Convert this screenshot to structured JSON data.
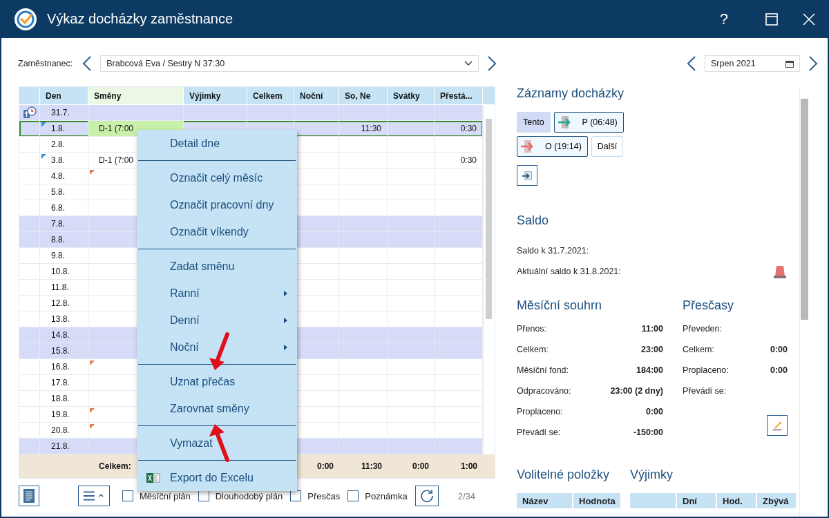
{
  "window": {
    "title": "Výkaz docházky zaměstnance",
    "help": "?"
  },
  "employee": {
    "label": "Zaměstnanec:",
    "value": "Brabcová Eva / Sestry N 37:30"
  },
  "month": {
    "value": "Srpen 2021"
  },
  "table": {
    "columns": [
      "Den",
      "Směny",
      "Výjimky",
      "Celkem",
      "Noční",
      "So, Ne",
      "Svátky",
      "Přestá..."
    ],
    "rows": [
      {
        "den": "31.7.",
        "weekend": true,
        "selected": false,
        "icon": true
      },
      {
        "den": "1.8.",
        "smeny": "D-1 (7:00",
        "so_ne": "11:30",
        "prescas": "0:30",
        "weekend": true,
        "selected": true,
        "note": true,
        "flag": false
      },
      {
        "den": "2.8.",
        "weekend": false,
        "selected": false
      },
      {
        "den": "3.8.",
        "smeny": "D-1 (7:00",
        "prescas": "0:30",
        "weekend": false,
        "selected": false,
        "note": true,
        "flag": false
      },
      {
        "den": "4.8.",
        "weekend": false,
        "selected": false,
        "note": false,
        "flag": true
      },
      {
        "den": "5.8.",
        "weekend": false,
        "selected": false
      },
      {
        "den": "6.8.",
        "weekend": false,
        "selected": false
      },
      {
        "den": "7.8.",
        "weekend": true,
        "selected": false
      },
      {
        "den": "8.8.",
        "weekend": true,
        "selected": false
      },
      {
        "den": "9.8.",
        "weekend": false,
        "selected": false
      },
      {
        "den": "10.8.",
        "weekend": false,
        "selected": false
      },
      {
        "den": "11.8.",
        "weekend": false,
        "selected": false
      },
      {
        "den": "12.8.",
        "weekend": false,
        "selected": false
      },
      {
        "den": "13.8.",
        "weekend": false,
        "selected": false
      },
      {
        "den": "14.8.",
        "weekend": true,
        "selected": false
      },
      {
        "den": "15.8.",
        "weekend": true,
        "selected": false
      },
      {
        "den": "16.8.",
        "weekend": false,
        "selected": false,
        "note": false,
        "flag": true
      },
      {
        "den": "17.8.",
        "weekend": false,
        "selected": false
      },
      {
        "den": "18.8.",
        "weekend": false,
        "selected": false
      },
      {
        "den": "19.8.",
        "weekend": false,
        "selected": false,
        "note": false,
        "flag": true
      },
      {
        "den": "20.8.",
        "weekend": false,
        "selected": false,
        "note": false,
        "flag": true
      },
      {
        "den": "21.8.",
        "weekend": true,
        "selected": false
      }
    ],
    "footer": {
      "label": "Celkem:",
      "nocni": "0:00",
      "so_ne": "11:30",
      "svatky": "0:00",
      "prescas": "1:00"
    }
  },
  "context_menu": [
    [
      {
        "label": "Detail dne",
        "submenu": false
      }
    ],
    [
      {
        "label": "Označit celý měsíc",
        "submenu": false
      },
      {
        "label": "Označit pracovní dny",
        "submenu": false
      },
      {
        "label": "Označit víkendy",
        "submenu": false
      }
    ],
    [
      {
        "label": "Zadat směnu",
        "submenu": false
      },
      {
        "label": "Ranní",
        "submenu": true
      },
      {
        "label": "Denní",
        "submenu": true
      },
      {
        "label": "Noční",
        "submenu": true
      }
    ],
    [
      {
        "label": "Uznat přečas",
        "submenu": false
      },
      {
        "label": "Zarovnat směny",
        "submenu": false
      }
    ],
    [
      {
        "label": "Vymazat",
        "submenu": false
      }
    ],
    [
      {
        "label": "Export do Excelu",
        "submenu": false
      }
    ]
  ],
  "bottom_bar": {
    "checkboxes": [
      {
        "label": "Měsíční plán",
        "checked": false
      },
      {
        "label": "Dlouhodobý plán",
        "checked": false
      },
      {
        "label": "Přesčas",
        "checked": false
      },
      {
        "label": "Poznámka",
        "checked": false
      }
    ],
    "page": "2/34"
  },
  "records": {
    "title": "Záznamy docházky",
    "buttons": [
      {
        "label": "Tento",
        "kind": "plain",
        "selected": true
      },
      {
        "label": "P (06:48)",
        "kind": "in",
        "selected": false
      },
      {
        "label": "O (19:14)",
        "kind": "out",
        "selected": false
      },
      {
        "label": "Další",
        "kind": "plain",
        "selected": false
      }
    ]
  },
  "saldo": {
    "title": "Saldo",
    "lines": [
      "Saldo k 31.7.2021:",
      "Aktuální saldo k 31.8.2021:"
    ]
  },
  "summary": {
    "title": "Měsíční souhrn",
    "rows": [
      {
        "label": "Přenos:",
        "value": "11:00"
      },
      {
        "label": "Celkem:",
        "value": "23:00"
      },
      {
        "label": "Měsíční fond:",
        "value": "184:00"
      },
      {
        "label": "Odpracováno:",
        "value": "23:00 (2 dny)"
      },
      {
        "label": "Proplaceno:",
        "value": "0:00"
      },
      {
        "label": "Převádí se:",
        "value": "-150:00"
      }
    ]
  },
  "overtime": {
    "title": "Přesčasy",
    "rows": [
      {
        "label": "Převeden:"
      },
      {
        "label": "Celkem:",
        "value": "0:00"
      },
      {
        "label": "Proplaceno:",
        "value": "0:00"
      },
      {
        "label": "Převádí se:"
      }
    ]
  },
  "optional": {
    "title": "Volitelné položky",
    "columns": [
      "Název",
      "Hodnota"
    ]
  },
  "exceptions": {
    "title": "Výjimky",
    "columns": [
      "Dní",
      "Hod.",
      "Zbývá"
    ]
  }
}
